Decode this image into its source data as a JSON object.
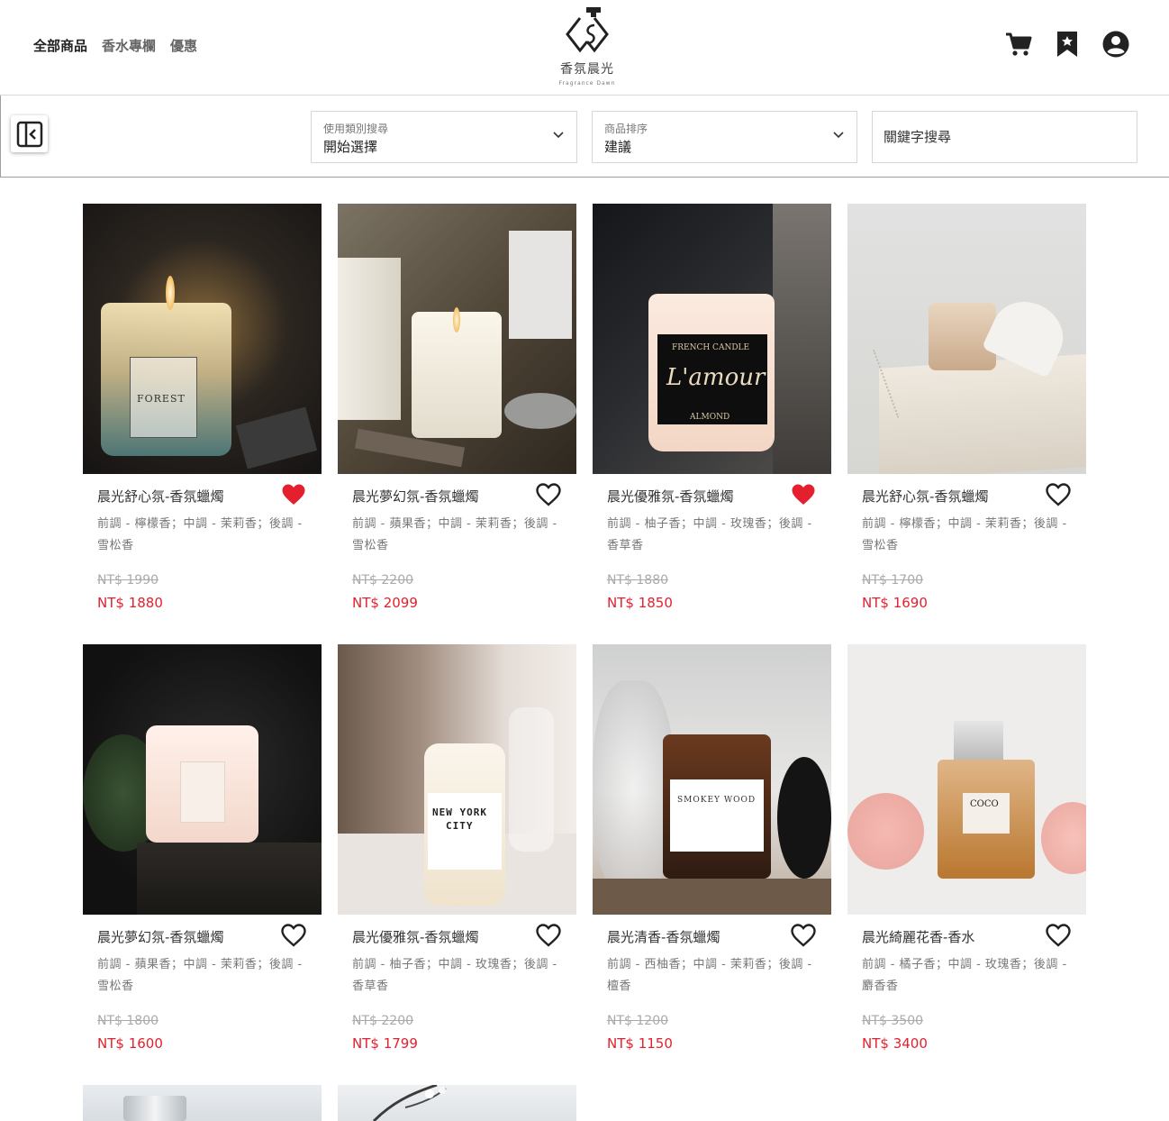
{
  "header": {
    "nav": [
      "全部商品",
      "香水專欄",
      "優惠"
    ],
    "brand_cn": "香氛晨光",
    "brand_en": "Fragrance Dawn",
    "icons": [
      "cart-icon",
      "bookmark-icon",
      "account-icon"
    ]
  },
  "filters": {
    "category": {
      "label": "使用類別搜尋",
      "value": "開始選擇"
    },
    "sort": {
      "label": "商品排序",
      "value": "建議"
    },
    "keyword_placeholder": "關鍵字搜尋"
  },
  "colors": {
    "accent_red": "#e4202e",
    "heart_filled": "#e4202e"
  },
  "products": [
    {
      "name": "晨光舒心氛-香氛蠟燭",
      "desc": "前調 - 檸檬香；中調 - 茉莉香；後調 - 雪松香",
      "old_price": "NT$ 1990",
      "price": "NT$ 1880",
      "favorited": true
    },
    {
      "name": "晨光夢幻氛-香氛蠟燭",
      "desc": "前調 - 蘋果香；中調 - 茉莉香；後調 - 雪松香",
      "old_price": "NT$ 2200",
      "price": "NT$ 2099",
      "favorited": false
    },
    {
      "name": "晨光優雅氛-香氛蠟燭",
      "desc": "前調 - 柚子香；中調 - 玫瑰香；後調 - 香草香",
      "old_price": "NT$ 1880",
      "price": "NT$ 1850",
      "favorited": true
    },
    {
      "name": "晨光舒心氛-香氛蠟燭",
      "desc": "前調 - 檸檬香；中調 - 茉莉香；後調 - 雪松香",
      "old_price": "NT$ 1700",
      "price": "NT$ 1690",
      "favorited": false
    },
    {
      "name": "晨光夢幻氛-香氛蠟燭",
      "desc": "前調 - 蘋果香；中調 - 茉莉香；後調 - 雪松香",
      "old_price": "NT$ 1800",
      "price": "NT$ 1600",
      "favorited": false
    },
    {
      "name": "晨光優雅氛-香氛蠟燭",
      "desc": "前調 - 柚子香；中調 - 玫瑰香；後調 - 香草香",
      "old_price": "NT$ 2200",
      "price": "NT$ 1799",
      "favorited": false
    },
    {
      "name": "晨光清香-香氛蠟燭",
      "desc": "前調 - 西柚香；中調 - 茉莉香；後調 - 檀香",
      "old_price": "NT$ 1200",
      "price": "NT$ 1150",
      "favorited": false
    },
    {
      "name": "晨光綺麗花香-香水",
      "desc": "前調 - 橘子香；中調 - 玫瑰香；後調 - 麝香香",
      "old_price": "NT$ 3500",
      "price": "NT$ 3400",
      "favorited": false
    }
  ]
}
